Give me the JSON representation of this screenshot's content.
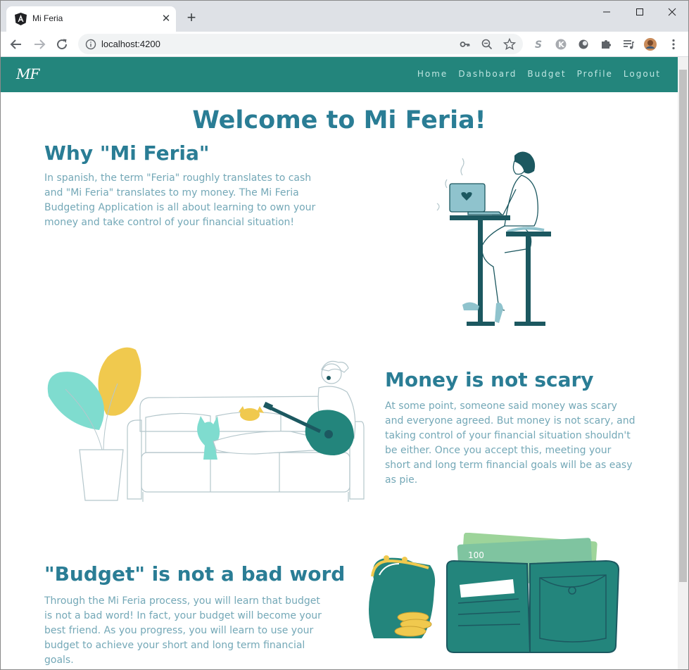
{
  "browser": {
    "tab_title": "Mi Feria",
    "url": "localhost:4200"
  },
  "navbar": {
    "brand": "MF",
    "links": [
      "Home",
      "Dashboard",
      "Budget",
      "Profile",
      "Logout"
    ]
  },
  "page": {
    "title": "Welcome to Mi Feria!",
    "sections": [
      {
        "heading": "Why \"Mi Feria\"",
        "text": "In spanish, the term \"Feria\" roughly translates to cash and \"Mi Feria\" translates to my money. The Mi Feria Budgeting Application is all about learning to own your money and take control of your financial situation!",
        "illustration": "woman-at-laptop-illustration"
      },
      {
        "heading": "Money is not scary",
        "text": "At some point, someone said money was scary and everyone agreed. But money is not scary, and taking control of your financial situation shouldn't be either. Once you accept this, meeting your short and long term financial goals will be as easy as pie.",
        "illustration": "woman-on-couch-with-guitar-illustration"
      },
      {
        "heading": "\"Budget\" is not a bad word",
        "text": "Through the Mi Feria process, you will learn that budget is not a bad word! In fact, your budget will become your best friend. As you progress, you will learn to use your budget to achieve your short and long term financial goals.",
        "illustration": "wallet-and-coin-purse-illustration"
      }
    ]
  },
  "colors": {
    "navbar": "#23857c",
    "heading": "#2a7d95",
    "body_text": "#74a8b7",
    "accent_teal": "#23857c",
    "accent_yellow": "#f0c94e",
    "accent_mint": "#7fdccf"
  }
}
